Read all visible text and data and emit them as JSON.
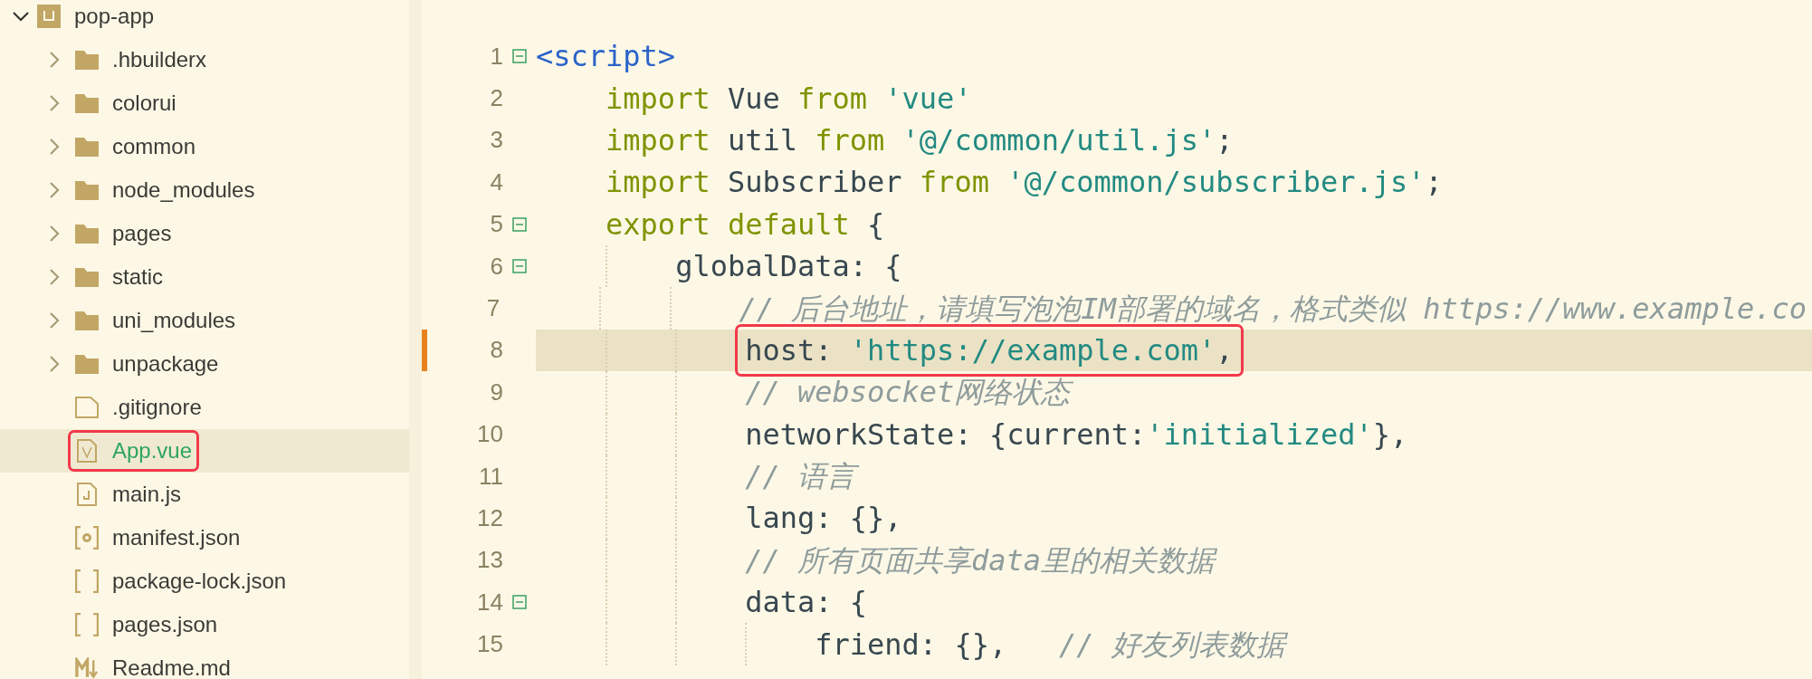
{
  "sidebar": {
    "tree": {
      "label": "pop-app",
      "kind": "project",
      "expanded": true,
      "selected": false,
      "boxed": false,
      "children": [
        {
          "label": ".hbuilderx",
          "kind": "folder",
          "expanded": false,
          "selected": false,
          "boxed": false
        },
        {
          "label": "colorui",
          "kind": "folder",
          "expanded": false,
          "selected": false,
          "boxed": false
        },
        {
          "label": "common",
          "kind": "folder",
          "expanded": false,
          "selected": false,
          "boxed": false
        },
        {
          "label": "node_modules",
          "kind": "folder",
          "expanded": false,
          "selected": false,
          "boxed": false
        },
        {
          "label": "pages",
          "kind": "folder",
          "expanded": false,
          "selected": false,
          "boxed": false
        },
        {
          "label": "static",
          "kind": "folder",
          "expanded": false,
          "selected": false,
          "boxed": false
        },
        {
          "label": "uni_modules",
          "kind": "folder",
          "expanded": false,
          "selected": false,
          "boxed": false
        },
        {
          "label": "unpackage",
          "kind": "folder",
          "expanded": false,
          "selected": false,
          "boxed": false
        },
        {
          "label": ".gitignore",
          "kind": "file",
          "selected": false,
          "boxed": false
        },
        {
          "label": "App.vue",
          "kind": "vue",
          "selected": true,
          "boxed": true
        },
        {
          "label": "main.js",
          "kind": "js",
          "selected": false,
          "boxed": false
        },
        {
          "label": "manifest.json",
          "kind": "config",
          "selected": false,
          "boxed": false
        },
        {
          "label": "package-lock.json",
          "kind": "json",
          "selected": false,
          "boxed": false
        },
        {
          "label": "pages.json",
          "kind": "json",
          "selected": false,
          "boxed": false
        },
        {
          "label": "Readme.md",
          "kind": "markdown",
          "selected": false,
          "boxed": false
        }
      ]
    }
  },
  "editor": {
    "lines": [
      {
        "number": "1",
        "fold": true,
        "current": false,
        "modified": false,
        "boxed": false,
        "tokens": [
          {
            "kind": "tag",
            "text": "<script>"
          }
        ],
        "children": [
          {
            "number": "2",
            "fold": false,
            "current": false,
            "modified": false,
            "boxed": false,
            "tokens": [
              {
                "kind": "keyword",
                "text": "import"
              },
              {
                "kind": "plain",
                "text": " Vue "
              },
              {
                "kind": "keyword",
                "text": "from"
              },
              {
                "kind": "string",
                "text": " 'vue'"
              }
            ]
          },
          {
            "number": "3",
            "fold": false,
            "current": false,
            "modified": false,
            "boxed": false,
            "tokens": [
              {
                "kind": "keyword",
                "text": "import"
              },
              {
                "kind": "plain",
                "text": " util "
              },
              {
                "kind": "keyword",
                "text": "from"
              },
              {
                "kind": "string",
                "text": " '@/common/util.js'"
              },
              {
                "kind": "plain",
                "text": ";"
              }
            ]
          },
          {
            "number": "4",
            "fold": false,
            "current": false,
            "modified": false,
            "boxed": false,
            "tokens": [
              {
                "kind": "keyword",
                "text": "import"
              },
              {
                "kind": "plain",
                "text": " Subscriber "
              },
              {
                "kind": "keyword",
                "text": "from"
              },
              {
                "kind": "string",
                "text": " '@/common/subscriber.js'"
              },
              {
                "kind": "plain",
                "text": ";"
              }
            ]
          },
          {
            "number": "5",
            "fold": true,
            "current": false,
            "modified": false,
            "boxed": false,
            "tokens": [
              {
                "kind": "keyword",
                "text": "export default"
              },
              {
                "kind": "plain",
                "text": " {"
              }
            ],
            "children": [
              {
                "number": "6",
                "fold": true,
                "current": false,
                "modified": false,
                "boxed": false,
                "tokens": [
                  {
                    "kind": "plain",
                    "text": "globalData: {"
                  }
                ],
                "children": [
                  {
                    "number": "7",
                    "fold": false,
                    "current": false,
                    "modified": false,
                    "boxed": false,
                    "tokens": [
                      {
                        "kind": "comment",
                        "text": "// 后台地址，请填写泡泡IM部署的域名，格式类似 https://www.example.co"
                      }
                    ]
                  },
                  {
                    "number": "8",
                    "fold": false,
                    "current": true,
                    "modified": true,
                    "boxed": true,
                    "tokens": [
                      {
                        "kind": "plain",
                        "text": "host: "
                      },
                      {
                        "kind": "string",
                        "text": "'https://example.com'"
                      },
                      {
                        "kind": "plain",
                        "text": ","
                      }
                    ]
                  },
                  {
                    "number": "9",
                    "fold": false,
                    "current": false,
                    "modified": false,
                    "boxed": false,
                    "tokens": [
                      {
                        "kind": "comment",
                        "text": "// websocket网络状态"
                      }
                    ]
                  },
                  {
                    "number": "10",
                    "fold": false,
                    "current": false,
                    "modified": false,
                    "boxed": false,
                    "tokens": [
                      {
                        "kind": "plain",
                        "text": "networkState: {current:"
                      },
                      {
                        "kind": "string",
                        "text": "'initialized'"
                      },
                      {
                        "kind": "plain",
                        "text": "},"
                      }
                    ]
                  },
                  {
                    "number": "11",
                    "fold": false,
                    "current": false,
                    "modified": false,
                    "boxed": false,
                    "tokens": [
                      {
                        "kind": "comment",
                        "text": "// 语言"
                      }
                    ]
                  },
                  {
                    "number": "12",
                    "fold": false,
                    "current": false,
                    "modified": false,
                    "boxed": false,
                    "tokens": [
                      {
                        "kind": "plain",
                        "text": "lang: {},"
                      }
                    ]
                  },
                  {
                    "number": "13",
                    "fold": false,
                    "current": false,
                    "modified": false,
                    "boxed": false,
                    "tokens": [
                      {
                        "kind": "comment",
                        "text": "// 所有页面共享data里的相关数据"
                      }
                    ]
                  },
                  {
                    "number": "14",
                    "fold": true,
                    "current": false,
                    "modified": false,
                    "boxed": false,
                    "tokens": [
                      {
                        "kind": "plain",
                        "text": "data: {"
                      }
                    ],
                    "children": [
                      {
                        "number": "15",
                        "fold": false,
                        "current": false,
                        "modified": false,
                        "boxed": false,
                        "tokens": [
                          {
                            "kind": "plain",
                            "text": "friend: {},   "
                          },
                          {
                            "kind": "comment",
                            "text": "// 好友列表数据"
                          }
                        ]
                      }
                    ]
                  }
                ]
              }
            ]
          }
        ]
      }
    ]
  }
}
